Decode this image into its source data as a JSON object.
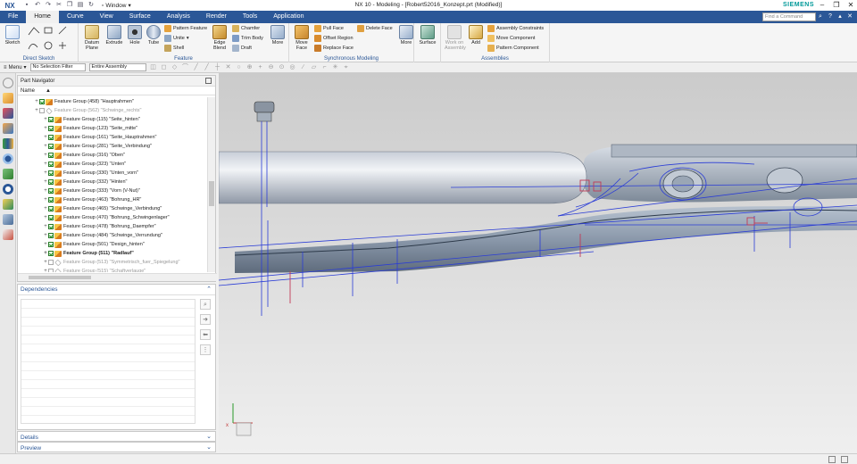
{
  "app": {
    "logo": "NX",
    "window_menu": "Window",
    "title": "NX 10 - Modeling - [Robert52016_Konzept.prt (Modified)]",
    "brand": "SIEMENS"
  },
  "tabs": [
    {
      "label": "File"
    },
    {
      "label": "Home"
    },
    {
      "label": "Curve"
    },
    {
      "label": "View"
    },
    {
      "label": "Surface"
    },
    {
      "label": "Analysis"
    },
    {
      "label": "Render"
    },
    {
      "label": "Tools"
    },
    {
      "label": "Application"
    }
  ],
  "command_search_placeholder": "Find a Command",
  "ribbon": {
    "direct_sketch": {
      "label": "Direct Sketch",
      "sketch": "Sketch"
    },
    "feature": {
      "label": "Feature",
      "datum_plane": "Datum Plane",
      "extrude": "Extrude",
      "hole": "Hole",
      "tube": "Tube",
      "pattern_feature": "Pattern Feature",
      "unite": "Unite",
      "shell": "Shell",
      "edge_blend": "Edge Blend",
      "chamfer": "Chamfer",
      "trim_body": "Trim Body",
      "draft": "Draft",
      "more": "More"
    },
    "sync": {
      "label": "Synchronous Modeling",
      "move_face": "Move Face",
      "pull_face": "Pull Face",
      "offset_region": "Offset Region",
      "replace_face": "Replace Face",
      "delete_face": "Delete Face",
      "more": "More"
    },
    "surface": {
      "label": "Surface"
    },
    "assemblies": {
      "label": "Assemblies",
      "work_on_assembly": "Work on Assembly",
      "add": "Add",
      "assembly_constraints": "Assembly Constraints",
      "move_component": "Move Component",
      "pattern_component": "Pattern Component"
    }
  },
  "selection_bar": {
    "menu": "Menu",
    "filter": "No Selection Filter",
    "scope": "Entire Assembly"
  },
  "part_navigator": {
    "title": "Part Navigator",
    "column": "Name",
    "rows": [
      {
        "text": "Feature Group (458) \"Hauptrahmen\"",
        "state": "normal",
        "indent": 1
      },
      {
        "text": "Feature Group (562) \"Schwinge_rechts\"",
        "state": "dim",
        "indent": 1
      },
      {
        "text": "Feature Group (115) \"Seite_hinten\"",
        "state": "normal",
        "indent": 2
      },
      {
        "text": "Feature Group (123) \"Seite_mitte\"",
        "state": "normal",
        "indent": 2
      },
      {
        "text": "Feature Group (161) \"Seite_Hauptrahmen\"",
        "state": "normal",
        "indent": 2
      },
      {
        "text": "Feature Group (281) \"Seite_Verbindung\"",
        "state": "normal",
        "indent": 2
      },
      {
        "text": "Feature Group (316) \"Oben\"",
        "state": "normal",
        "indent": 2
      },
      {
        "text": "Feature Group (323) \"Unten\"",
        "state": "normal",
        "indent": 2
      },
      {
        "text": "Feature Group (330) \"Unten_vorn\"",
        "state": "normal",
        "indent": 2
      },
      {
        "text": "Feature Group (332) \"Hinten\"",
        "state": "normal",
        "indent": 2
      },
      {
        "text": "Feature Group (333) \"Vorn (V-Nut)\"",
        "state": "normal",
        "indent": 2
      },
      {
        "text": "Feature Group (463) \"Bohrung_HR\"",
        "state": "normal",
        "indent": 2
      },
      {
        "text": "Feature Group (465) \"Schwinge_Verbindung\"",
        "state": "normal",
        "indent": 2
      },
      {
        "text": "Feature Group (470) \"Bohrung_Schwingenlager\"",
        "state": "normal",
        "indent": 2
      },
      {
        "text": "Feature Group (478) \"Bohrung_Daempfer\"",
        "state": "normal",
        "indent": 2
      },
      {
        "text": "Feature Group (484) \"Schwinge_Verrundung\"",
        "state": "normal",
        "indent": 2
      },
      {
        "text": "Feature Group (501) \"Design_hinten\"",
        "state": "normal",
        "indent": 2
      },
      {
        "text": "Feature Group (511) \"Radlauf\"",
        "state": "bold",
        "indent": 2
      },
      {
        "text": "Feature Group (513) \"Symmetrisch_fuer_Spiegelung\"",
        "state": "dim",
        "indent": 2
      },
      {
        "text": "Feature Group (515) \"Schaftverlauge\"",
        "state": "dim",
        "indent": 2
      }
    ]
  },
  "panels": {
    "dependencies": "Dependencies",
    "details": "Details",
    "preview": "Preview"
  },
  "colors": {
    "accent": "#2b5797",
    "brand": "#009999"
  }
}
